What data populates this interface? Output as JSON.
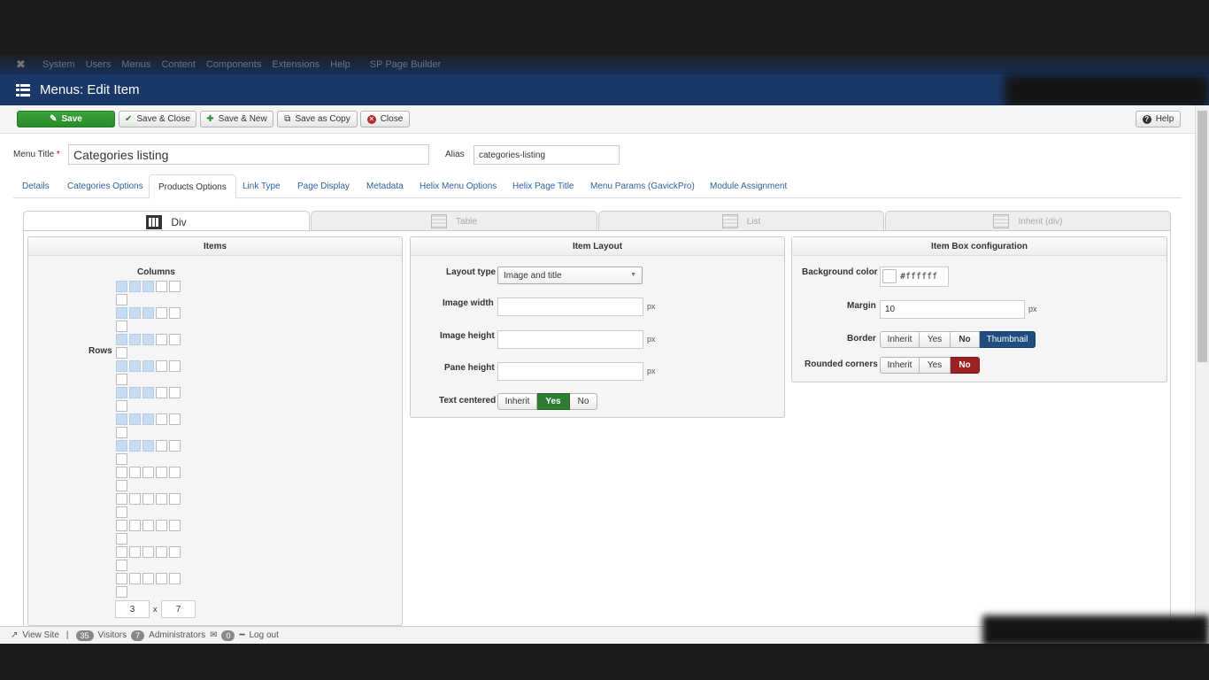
{
  "topnav": {
    "items": [
      "System",
      "Users",
      "Menus",
      "Content",
      "Components",
      "Extensions",
      "Help",
      "SP Page Builder"
    ]
  },
  "header": {
    "title": "Menus: Edit Item"
  },
  "toolbar": {
    "save_label": "Save",
    "save_close_label": "Save & Close",
    "save_new_label": "Save & New",
    "save_copy_label": "Save as Copy",
    "close_label": "Close",
    "help_label": "Help"
  },
  "form": {
    "menu_title_label": "Menu Title",
    "menu_title_required": "*",
    "menu_title_value": "Categories listing",
    "alias_label": "Alias",
    "alias_value": "categories-listing"
  },
  "tabs": [
    "Details",
    "Categories Options",
    "Products Options",
    "Link Type",
    "Page Display",
    "Metadata",
    "Helix Menu Options",
    "Helix Page Title",
    "Menu Params (GavickPro)",
    "Module Assignment"
  ],
  "active_tab": "Products Options",
  "layout_tabs": [
    "Div",
    "Table",
    "List",
    "Inherit (div)"
  ],
  "active_layout_tab": "Div",
  "items_panel": {
    "title": "Items",
    "columns_label": "Columns",
    "rows_label": "Rows",
    "cols_value": "3",
    "times": "x",
    "rows_value": "7",
    "selected_cols": 3,
    "selected_rows": 7,
    "grid_rows": 12,
    "grid_cols": 5
  },
  "layout_panel": {
    "title": "Item Layout",
    "layout_type_label": "Layout type",
    "layout_type_value": "Image and title",
    "image_width_label": "Image width",
    "image_height_label": "Image height",
    "pane_height_label": "Pane height",
    "px": "px",
    "text_centered_label": "Text centered",
    "text_centered_options": [
      "Inherit",
      "Yes",
      "No"
    ],
    "text_centered_selected": "Yes"
  },
  "box_panel": {
    "title": "Item Box configuration",
    "bg_color_label": "Background color",
    "bg_color_value": "#ffffff",
    "margin_label": "Margin",
    "margin_value": "10",
    "px": "px",
    "border_label": "Border",
    "border_options": [
      "Inherit",
      "Yes",
      "No",
      "Thumbnail"
    ],
    "border_selected": "Thumbnail",
    "rounded_label": "Rounded corners",
    "rounded_options": [
      "Inherit",
      "Yes",
      "No"
    ],
    "rounded_selected": "No"
  },
  "statusbar": {
    "view_site": "View Site",
    "visitors_count": "35",
    "visitors_label": "Visitors",
    "admins_count": "7",
    "admins_label": "Administrators",
    "messages_count": "0",
    "logout_label": "Log out"
  },
  "colors": {
    "header_blue": "#1a3867",
    "save_green": "#2a8a2a",
    "yes_green": "#2e7d32",
    "thumbnail_blue": "#1f4d7f",
    "no_red": "#9c2222",
    "grid_selected": "#c7dcf1"
  }
}
